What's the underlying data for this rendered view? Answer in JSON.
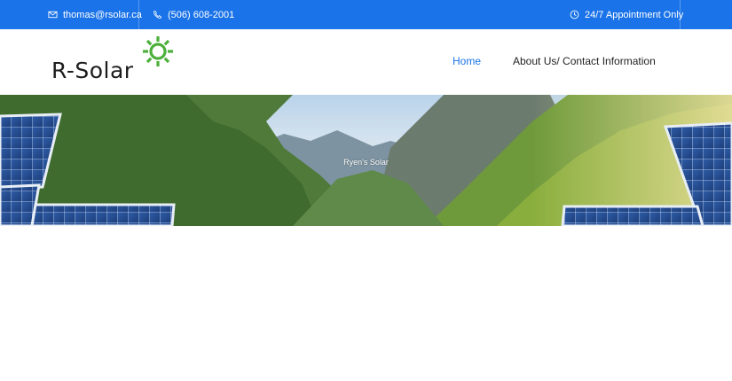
{
  "topbar": {
    "email": "thomas@rsolar.ca",
    "phone": "(506) 608-2001",
    "hours": "24/7 Appointment Only",
    "icons": [
      "envelope-icon",
      "phone-icon",
      "clock-icon"
    ],
    "background_color": "#1a73e8"
  },
  "header": {
    "logo_text": "R-Solar",
    "logo_icon": "sun-icon",
    "logo_icon_color": "#4caf3a",
    "nav": [
      {
        "label": "Home",
        "active": true
      },
      {
        "label": "About Us/ Contact Information",
        "active": false
      }
    ],
    "active_color": "#1a73e8"
  },
  "hero": {
    "caption": "Ryen's Solar"
  }
}
